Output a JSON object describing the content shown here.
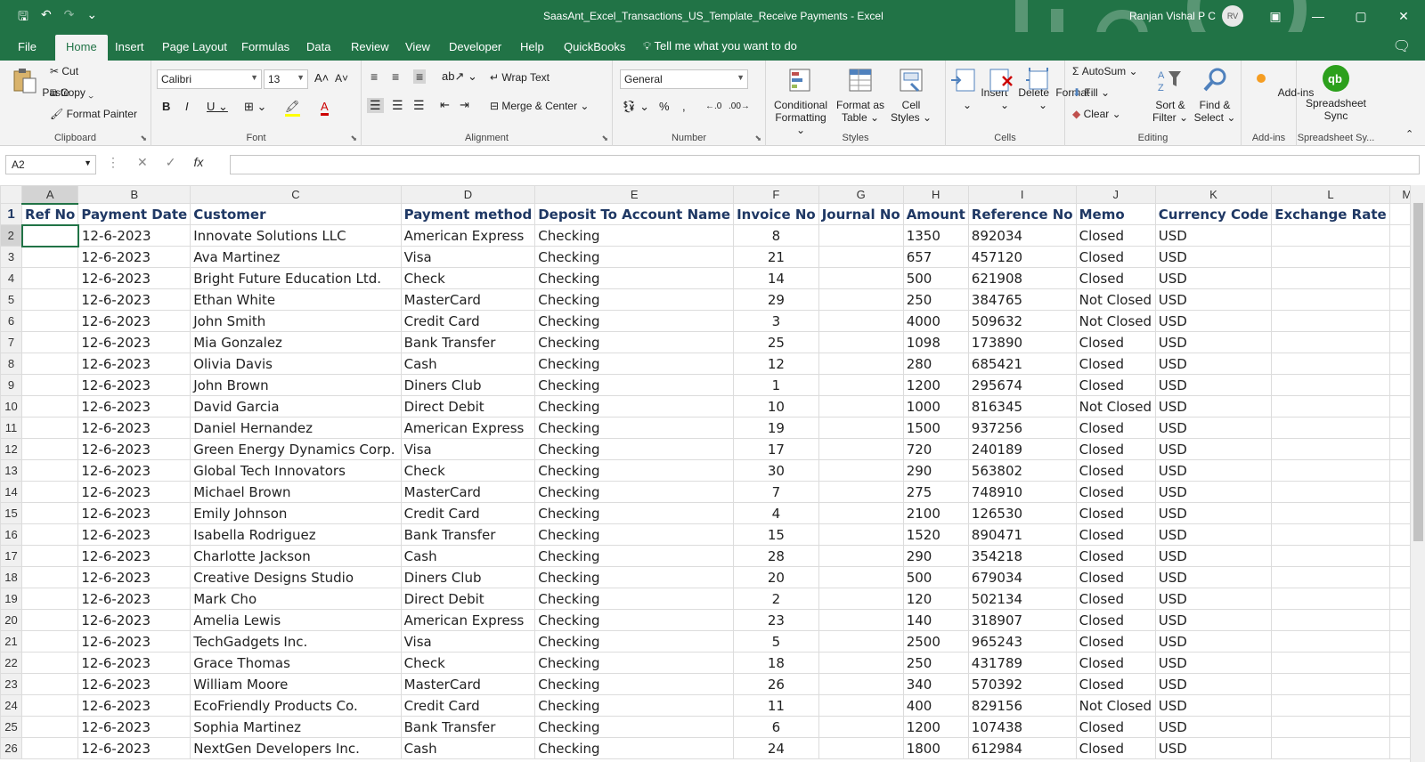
{
  "app": {
    "title": "SaasAnt_Excel_Transactions_US_Template_Receive Payments  -  Excel",
    "user": "Ranjan Vishal P C",
    "initials": "RV",
    "accent": "#217346"
  },
  "qat": {
    "save": "🖫",
    "undo": "↶",
    "redo": "↷",
    "more": "⌄"
  },
  "window": {
    "ribbon_opts": "▣",
    "min": "—",
    "max": "▢",
    "close": "✕"
  },
  "tabs": [
    "File",
    "Home",
    "Insert",
    "Page Layout",
    "Formulas",
    "Data",
    "Review",
    "View",
    "Developer",
    "Help",
    "QuickBooks"
  ],
  "tell_me": "Tell me what you want to do",
  "ribbon": {
    "clipboard": {
      "label": "Clipboard",
      "paste": "Paste",
      "cut": "Cut",
      "copy": "Copy",
      "format_painter": "Format Painter"
    },
    "font": {
      "label": "Font",
      "name": "Calibri",
      "size": "13"
    },
    "alignment": {
      "label": "Alignment",
      "wrap": "Wrap Text",
      "merge": "Merge & Center"
    },
    "number": {
      "label": "Number",
      "format": "General"
    },
    "styles": {
      "label": "Styles",
      "cond": "Conditional Formatting",
      "table": "Format as Table",
      "cell": "Cell Styles"
    },
    "cells": {
      "label": "Cells",
      "insert": "Insert",
      "delete": "Delete",
      "format": "Format"
    },
    "editing": {
      "label": "Editing",
      "autosum": "AutoSum",
      "fill": "Fill",
      "clear": "Clear",
      "sort": "Sort & Filter",
      "find": "Find & Select"
    },
    "addins": {
      "label": "Add-ins",
      "button": "Add-ins"
    },
    "sync": {
      "label": "Spreadsheet Sy...",
      "button": "Spreadsheet Sync"
    }
  },
  "formula_bar": {
    "name_box": "A2",
    "formula": ""
  },
  "columns": [
    "A",
    "B",
    "C",
    "D",
    "E",
    "F",
    "G",
    "H",
    "I",
    "J",
    "K",
    "L",
    "M"
  ],
  "headers": [
    "Ref No",
    "Payment Date",
    "Customer",
    "Payment method",
    "Deposit To Account Name",
    "Invoice No",
    "Journal No",
    "Amount",
    "Reference No",
    "Memo",
    "Currency Code",
    "Exchange Rate",
    ""
  ],
  "rows": [
    [
      "",
      "12-6-2023",
      "Innovate Solutions LLC",
      "American Express",
      "Checking",
      "8",
      "",
      "1350",
      "892034",
      "Closed",
      "USD",
      "",
      ""
    ],
    [
      "",
      "12-6-2023",
      "Ava Martinez",
      "Visa",
      "Checking",
      "21",
      "",
      "657",
      "457120",
      "Closed",
      "USD",
      "",
      ""
    ],
    [
      "",
      "12-6-2023",
      "Bright Future Education Ltd.",
      "Check",
      "Checking",
      "14",
      "",
      "500",
      "621908",
      "Closed",
      "USD",
      "",
      ""
    ],
    [
      "",
      "12-6-2023",
      "Ethan White",
      "MasterCard",
      "Checking",
      "29",
      "",
      "250",
      "384765",
      "Not Closed",
      "USD",
      "",
      ""
    ],
    [
      "",
      "12-6-2023",
      "John Smith",
      "Credit Card",
      "Checking",
      "3",
      "",
      "4000",
      "509632",
      "Not Closed",
      "USD",
      "",
      ""
    ],
    [
      "",
      "12-6-2023",
      "Mia Gonzalez",
      "Bank Transfer",
      "Checking",
      "25",
      "",
      "1098",
      "173890",
      "Closed",
      "USD",
      "",
      ""
    ],
    [
      "",
      "12-6-2023",
      "Olivia Davis",
      "Cash",
      "Checking",
      "12",
      "",
      "280",
      "685421",
      "Closed",
      "USD",
      "",
      ""
    ],
    [
      "",
      "12-6-2023",
      "John Brown",
      "Diners Club",
      "Checking",
      "1",
      "",
      "1200",
      "295674",
      "Closed",
      "USD",
      "",
      ""
    ],
    [
      "",
      "12-6-2023",
      "David Garcia",
      "Direct Debit",
      "Checking",
      "10",
      "",
      "1000",
      "816345",
      "Not Closed",
      "USD",
      "",
      ""
    ],
    [
      "",
      "12-6-2023",
      "Daniel Hernandez",
      "American Express",
      "Checking",
      "19",
      "",
      "1500",
      "937256",
      "Closed",
      "USD",
      "",
      ""
    ],
    [
      "",
      "12-6-2023",
      "Green Energy Dynamics Corp.",
      "Visa",
      "Checking",
      "17",
      "",
      "720",
      "240189",
      "Closed",
      "USD",
      "",
      ""
    ],
    [
      "",
      "12-6-2023",
      "Global Tech Innovators",
      "Check",
      "Checking",
      "30",
      "",
      "290",
      "563802",
      "Closed",
      "USD",
      "",
      ""
    ],
    [
      "",
      "12-6-2023",
      "Michael Brown",
      "MasterCard",
      "Checking",
      "7",
      "",
      "275",
      "748910",
      "Closed",
      "USD",
      "",
      ""
    ],
    [
      "",
      "12-6-2023",
      "Emily Johnson",
      "Credit Card",
      "Checking",
      "4",
      "",
      "2100",
      "126530",
      "Closed",
      "USD",
      "",
      ""
    ],
    [
      "",
      "12-6-2023",
      "Isabella Rodriguez",
      "Bank Transfer",
      "Checking",
      "15",
      "",
      "1520",
      "890471",
      "Closed",
      "USD",
      "",
      ""
    ],
    [
      "",
      "12-6-2023",
      "Charlotte Jackson",
      "Cash",
      "Checking",
      "28",
      "",
      "290",
      "354218",
      "Closed",
      "USD",
      "",
      ""
    ],
    [
      "",
      "12-6-2023",
      "Creative Designs Studio",
      "Diners Club",
      "Checking",
      "20",
      "",
      "500",
      "679034",
      "Closed",
      "USD",
      "",
      ""
    ],
    [
      "",
      "12-6-2023",
      "Mark Cho",
      "Direct Debit",
      "Checking",
      "2",
      "",
      "120",
      "502134",
      "Closed",
      "USD",
      "",
      ""
    ],
    [
      "",
      "12-6-2023",
      "Amelia Lewis",
      "American Express",
      "Checking",
      "23",
      "",
      "140",
      "318907",
      "Closed",
      "USD",
      "",
      ""
    ],
    [
      "",
      "12-6-2023",
      "TechGadgets Inc.",
      "Visa",
      "Checking",
      "5",
      "",
      "2500",
      "965243",
      "Closed",
      "USD",
      "",
      ""
    ],
    [
      "",
      "12-6-2023",
      "Grace Thomas",
      "Check",
      "Checking",
      "18",
      "",
      "250",
      "431789",
      "Closed",
      "USD",
      "",
      ""
    ],
    [
      "",
      "12-6-2023",
      "William Moore",
      "MasterCard",
      "Checking",
      "26",
      "",
      "340",
      "570392",
      "Closed",
      "USD",
      "",
      ""
    ],
    [
      "",
      "12-6-2023",
      "EcoFriendly Products Co.",
      "Credit Card",
      "Checking",
      "11",
      "",
      "400",
      "829156",
      "Not Closed",
      "USD",
      "",
      ""
    ],
    [
      "",
      "12-6-2023",
      "Sophia Martinez",
      "Bank Transfer",
      "Checking",
      "6",
      "",
      "1200",
      "107438",
      "Closed",
      "USD",
      "",
      ""
    ],
    [
      "",
      "12-6-2023",
      "NextGen Developers Inc.",
      "Cash",
      "Checking",
      "24",
      "",
      "1800",
      "612984",
      "Closed",
      "USD",
      "",
      ""
    ]
  ]
}
